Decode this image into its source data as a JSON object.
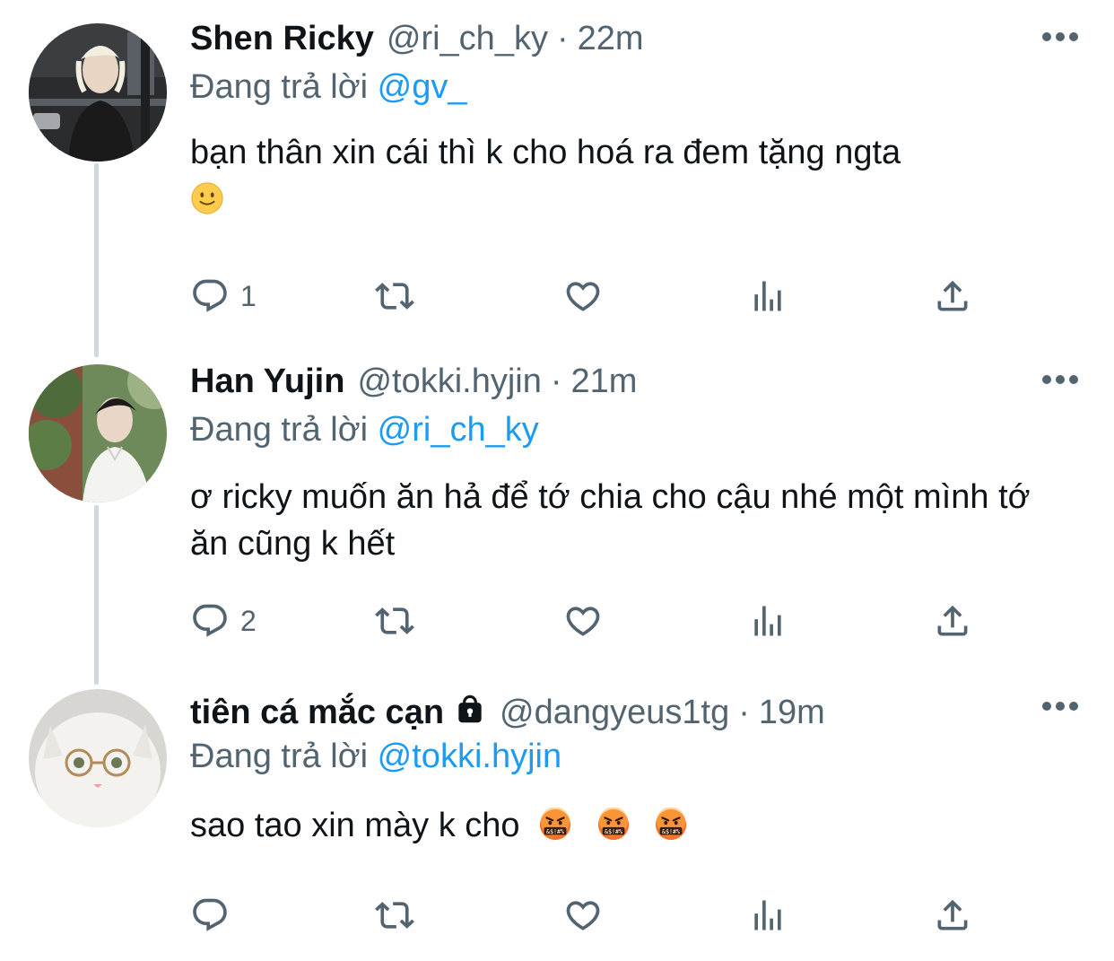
{
  "replying_prefix": "Đang trả lời",
  "tweets": [
    {
      "name": "Shen Ricky",
      "handle": "@ri_ch_ky",
      "separator": "·",
      "time": "22m",
      "replying_to": "@gv_",
      "text": "bạn thân xin cái thì k cho hoá ra đem tặng ngta",
      "emoji": "slightly-smiling-face",
      "reply_count": "1",
      "protected": false
    },
    {
      "name": "Han Yujin",
      "handle": "@tokki.hyjin",
      "separator": "·",
      "time": "21m",
      "replying_to": "@ri_ch_ky",
      "text": "ơ ricky muốn ăn hả để tớ chia cho cậu nhé một mình tớ ăn cũng k hết",
      "emoji": "",
      "reply_count": "2",
      "protected": false
    },
    {
      "name": "tiên cá mắc cạn",
      "handle": "@dangyeus1tg",
      "separator": "·",
      "time": "19m",
      "replying_to": "@tokki.hyjin",
      "text": "sao tao xin mày k cho",
      "emoji": "face-with-symbols-on-mouth x3",
      "reply_count": "",
      "protected": true
    }
  ],
  "colors": {
    "text": "#0f1419",
    "secondary": "#536471",
    "link": "#1d9bf0",
    "thread_line": "#cfd9de"
  },
  "icons": [
    "reply-icon",
    "retweet-icon",
    "like-icon",
    "views-icon",
    "share-icon",
    "more-icon",
    "lock-icon"
  ]
}
